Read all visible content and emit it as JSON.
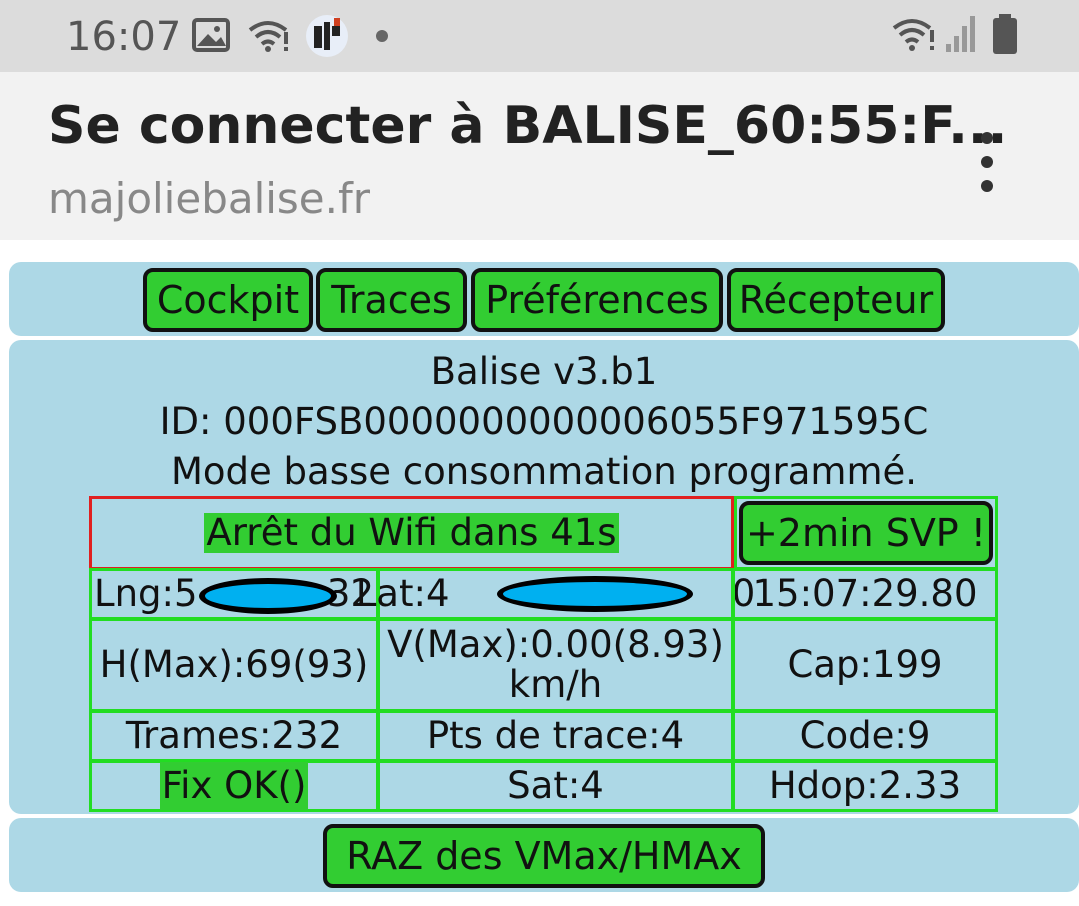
{
  "status_bar": {
    "time": "16:07"
  },
  "header": {
    "title": "Se connecter à BALISE_60:55:F...",
    "url": "majoliebalise.fr"
  },
  "nav": {
    "cockpit": "Cockpit",
    "traces": "Traces",
    "preferences": "Préférences",
    "recepteur": "Récepteur"
  },
  "info": {
    "version": "Balise v3.b1",
    "id": "ID: 000FSB0000000000006055F971595C",
    "mode": "Mode basse consommation programmé."
  },
  "wifi": {
    "stop_text": "Arrêt du Wifi dans 41s",
    "extend_button": "+2min SVP !"
  },
  "grid": {
    "lng": "Lng:5           32",
    "lat": "Lat:4                        0",
    "time": "15:07:29.80",
    "h_max": "H(Max):69(93)",
    "v_max": "V(Max):0.00(8.93)",
    "v_unit": "km/h",
    "cap": "Cap:199",
    "trames": "Trames:232",
    "pts_trace": "Pts de trace:4",
    "code": "Code:9",
    "fix": "Fix OK()",
    "sat": "Sat:4",
    "hdop": "Hdop:2.33"
  },
  "reset_button": "RAZ des VMax/HMAx",
  "colors": {
    "panel_bg": "#add8e6",
    "button_green": "#32cd32",
    "grid_border": "#22dd22",
    "alert_border": "#e02020",
    "redaction_blue": "#00b0f0"
  }
}
